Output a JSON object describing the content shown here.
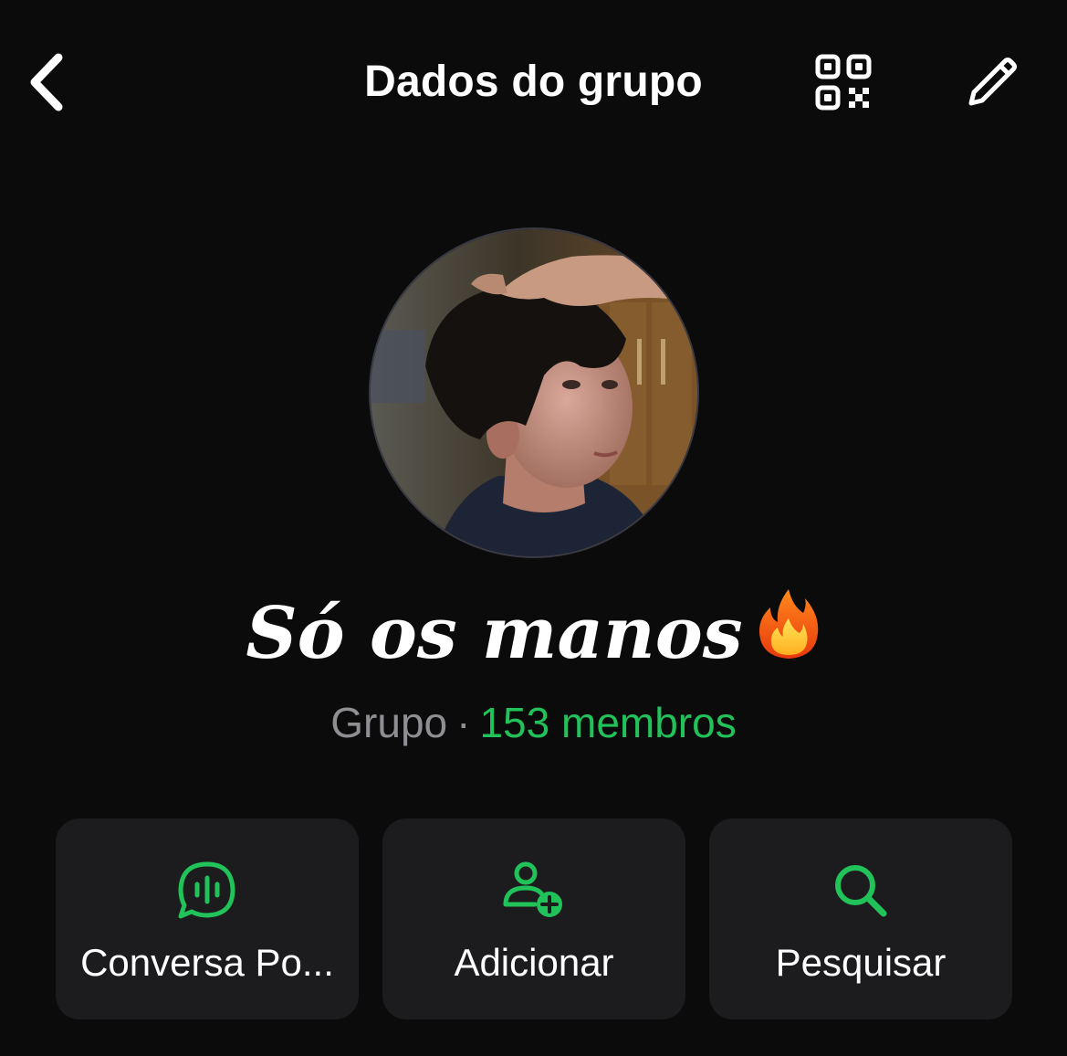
{
  "header": {
    "title": "Dados do grupo",
    "icons": {
      "back": "chevron-left-icon",
      "qr": "qr-code-icon",
      "edit": "pencil-icon"
    }
  },
  "group": {
    "name": "Só os manos",
    "emoji": "fire-icon",
    "type": "Grupo",
    "separator": "·",
    "members": "153 membros"
  },
  "actions": [
    {
      "label": "Conversa Po...",
      "icon": "voice-chat-icon"
    },
    {
      "label": "Adicionar",
      "icon": "add-person-icon"
    },
    {
      "label": "Pesquisar",
      "icon": "search-icon"
    }
  ],
  "colors": {
    "background": "#0b0b0b",
    "card": "#1c1c1e",
    "accent": "#22c25a",
    "muted": "#8e8e93",
    "text": "#ffffff"
  }
}
